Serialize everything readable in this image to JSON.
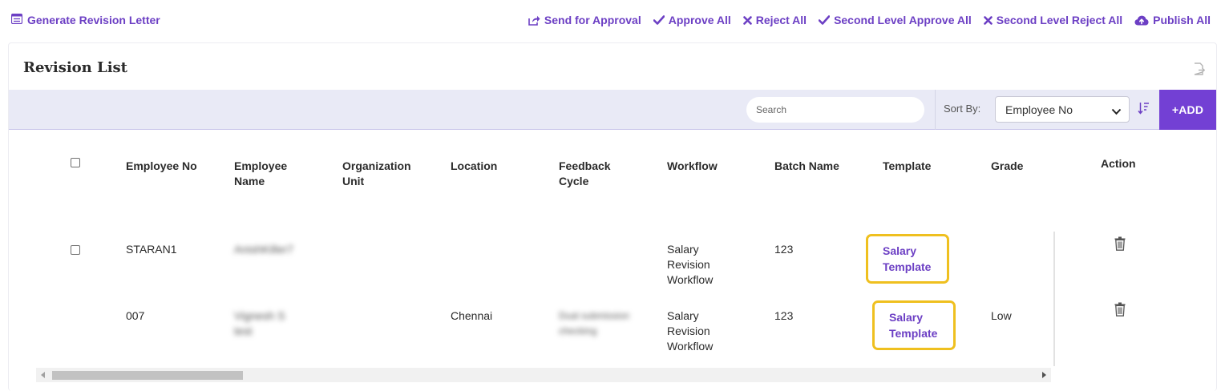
{
  "toolbar": {
    "generate_revision_letter": "Generate Revision Letter",
    "send_for_approval": "Send for Approval",
    "approve_all": "Approve All",
    "reject_all": "Reject All",
    "second_level_approve_all": "Second Level Approve All",
    "second_level_reject_all": "Second Level Reject All",
    "publish_all": "Publish All"
  },
  "card": {
    "title": "Revision List"
  },
  "search": {
    "placeholder": "Search",
    "value": ""
  },
  "sort": {
    "label": "Sort By:",
    "selected": "Employee No"
  },
  "add_button": "+ADD",
  "table": {
    "headers": {
      "employee_no": "Employee No",
      "employee_name": "Employee Name",
      "organization_unit": "Organization Unit",
      "location": "Location",
      "feedback_cycle": "Feedback Cycle",
      "workflow": "Workflow",
      "batch_name": "Batch Name",
      "template": "Template",
      "grade": "Grade",
      "action": "Action"
    },
    "rows": [
      {
        "employee_no": "STARAN1",
        "employee_name": "AnishKiller7",
        "organization_unit": "",
        "location": "",
        "feedback_cycle": "",
        "workflow": "Salary Revision Workflow",
        "batch_name": "123",
        "template": "Salary Template",
        "grade": ""
      },
      {
        "employee_no": "007",
        "employee_name": "Vignesh S test",
        "organization_unit": "",
        "location": "Chennai",
        "feedback_cycle": "Dual submission checking",
        "workflow": "Salary Revision Workflow",
        "batch_name": "123",
        "template": "Salary Template",
        "grade": "Low"
      }
    ]
  },
  "colors": {
    "accent": "#6c3fc4",
    "add_button_bg": "#7340d4",
    "band_bg": "#e9eaf6",
    "highlight_border": "#efc01f"
  },
  "icons": {
    "generate_letter": "list-icon",
    "send_for_approval": "share-icon",
    "approve": "check-icon",
    "reject": "x-icon",
    "publish": "cloud-upload-icon",
    "export": "export-icon",
    "sort_order": "sort-descending-icon",
    "delete": "trash-icon"
  }
}
